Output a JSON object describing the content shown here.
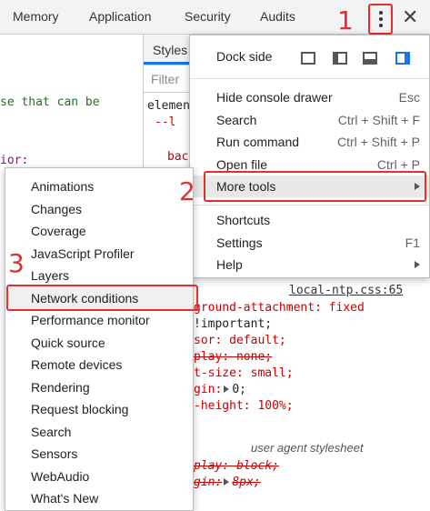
{
  "tabs": [
    "Memory",
    "Application",
    "Security",
    "Audits"
  ],
  "icons": {
    "menu": "vertical-ellipsis-icon",
    "close": "close-icon",
    "submenu": "chevron-right-icon"
  },
  "colors": {
    "annotation_red": "#e62e2e",
    "dock_active_blue": "#1a73e8",
    "code_green": "#236e25",
    "code_purple": "#881280",
    "code_red": "#c80000"
  },
  "left_pane": {
    "code_lines": [
      "se that can be",
      "ior:"
    ]
  },
  "styles_pane": {
    "tab_label": "Styles",
    "filter_placeholder": "Filter",
    "element_text": "elemen",
    "prop_1": "--l",
    "prop_2": "bac",
    "source_link": "local-ntp.css:65",
    "rules": [
      "ground-attachment: fixed",
      "!important;",
      "sor: default;",
      "play: none;",
      "t-size: small;",
      "gin:",
      "0;",
      "-height: 100%;"
    ],
    "ua_label": "user agent stylesheet",
    "ua_rules": [
      "play: block;",
      "gin:",
      "8px;"
    ]
  },
  "main_menu": {
    "dock_side": "Dock side",
    "items": [
      {
        "label": "Hide console drawer",
        "shortcut": "Esc"
      },
      {
        "label": "Search",
        "shortcut": "Ctrl + Shift + F"
      },
      {
        "label": "Run command",
        "shortcut": "Ctrl + Shift + P"
      },
      {
        "label": "Open file",
        "shortcut": "Ctrl + P"
      },
      {
        "label": "More tools",
        "shortcut": ""
      }
    ],
    "items2": [
      {
        "label": "Shortcuts",
        "shortcut": ""
      },
      {
        "label": "Settings",
        "shortcut": "F1"
      },
      {
        "label": "Help",
        "shortcut": ""
      }
    ]
  },
  "more_tools_menu": [
    "Animations",
    "Changes",
    "Coverage",
    "JavaScript Profiler",
    "Layers",
    "Network conditions",
    "Performance monitor",
    "Quick source",
    "Remote devices",
    "Rendering",
    "Request blocking",
    "Search",
    "Sensors",
    "WebAudio",
    "What's New"
  ],
  "annotations": [
    "1",
    "2",
    "3"
  ]
}
